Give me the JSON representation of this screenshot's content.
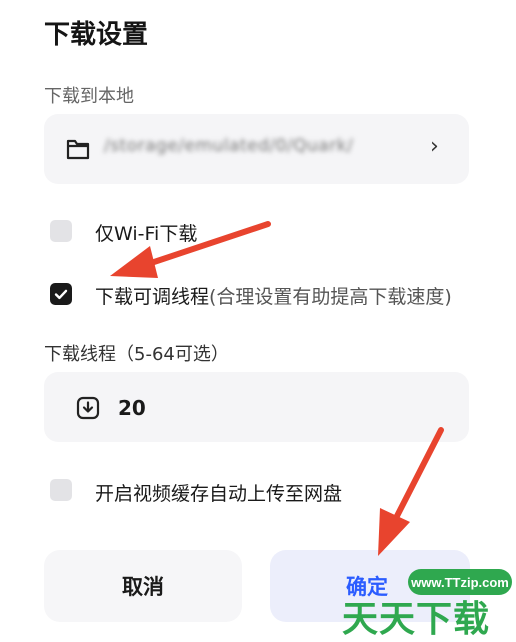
{
  "dialog": {
    "title": "下载设置",
    "download_to_local_label": "下载到本地",
    "path_value": "/storage/emulated/0/Quark/",
    "wifi_only_label": "仅Wi-Fi下载",
    "wifi_only_checked": false,
    "adjustable_threads_label": "下载可调线程",
    "adjustable_threads_hint": "(合理设置有助提高下载速度)",
    "adjustable_threads_checked": true,
    "threads_section_label": "下载线程（5-64可选）",
    "threads_value": "20",
    "auto_upload_label": "开启视频缓存自动上传至网盘",
    "auto_upload_checked": false,
    "cancel_label": "取消",
    "confirm_label": "确定"
  },
  "watermark": {
    "url": "www.TTzip.com",
    "brand": "天天下载"
  },
  "colors": {
    "accent": "#2b5cff",
    "arrow": "#e8442e",
    "watermark": "#2fa84f"
  }
}
